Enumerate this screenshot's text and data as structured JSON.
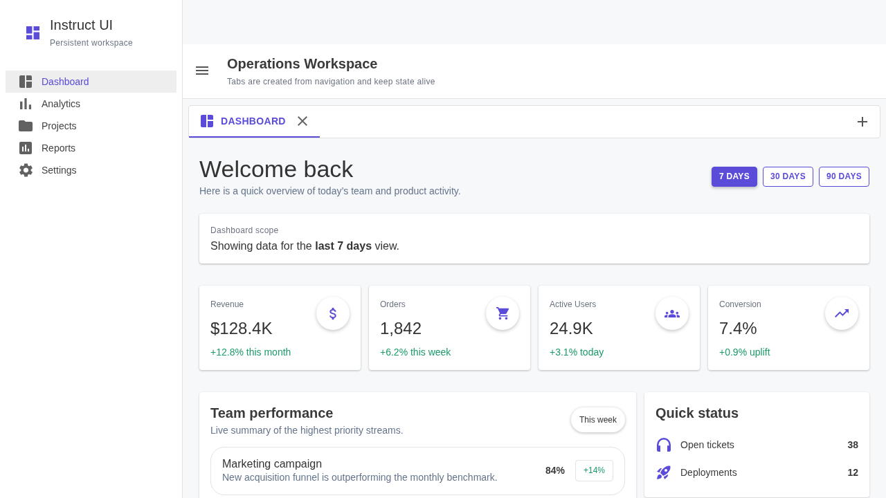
{
  "sidebar": {
    "brand": {
      "title": "Instruct UI",
      "subtitle": "Persistent workspace"
    },
    "items": [
      {
        "label": "Dashboard",
        "selected": true
      },
      {
        "label": "Analytics",
        "selected": false
      },
      {
        "label": "Projects",
        "selected": false
      },
      {
        "label": "Reports",
        "selected": false
      },
      {
        "label": "Settings",
        "selected": false
      }
    ]
  },
  "header": {
    "title": "Operations Workspace",
    "subtitle": "Tabs are created from navigation and keep state alive"
  },
  "tabs": [
    {
      "label": "DASHBOARD",
      "selected": true
    }
  ],
  "page": {
    "title": "Welcome back",
    "subtitle": "Here is a quick overview of today’s team and product activity.",
    "ranges": [
      {
        "label": "7 DAYS",
        "selected": true
      },
      {
        "label": "30 DAYS",
        "selected": false
      },
      {
        "label": "90 DAYS",
        "selected": false
      }
    ]
  },
  "scope": {
    "label": "Dashboard scope",
    "text": "Showing data for the **last 7 days** view."
  },
  "kpis": [
    {
      "label": "Revenue",
      "value": "$128.4K",
      "change": "+12.8% this month"
    },
    {
      "label": "Orders",
      "value": "1,842",
      "change": "+6.2% this week"
    },
    {
      "label": "Active Users",
      "value": "24.9K",
      "change": "+3.1% today"
    },
    {
      "label": "Conversion",
      "value": "7.4%",
      "change": "+0.9% uplift"
    }
  ],
  "team_performance": {
    "title": "Team performance",
    "subtitle": "Live summary of the highest priority streams.",
    "period": "This week",
    "items": [
      {
        "title": "Marketing campaign",
        "description": "New acquisition funnel is outperforming the monthly benchmark.",
        "percent": "84%",
        "delta": "+14%"
      }
    ]
  },
  "quick_status": {
    "title": "Quick status",
    "rows": [
      {
        "label": "Open tickets",
        "value": "38"
      },
      {
        "label": "Deployments",
        "value": "12"
      }
    ]
  }
}
